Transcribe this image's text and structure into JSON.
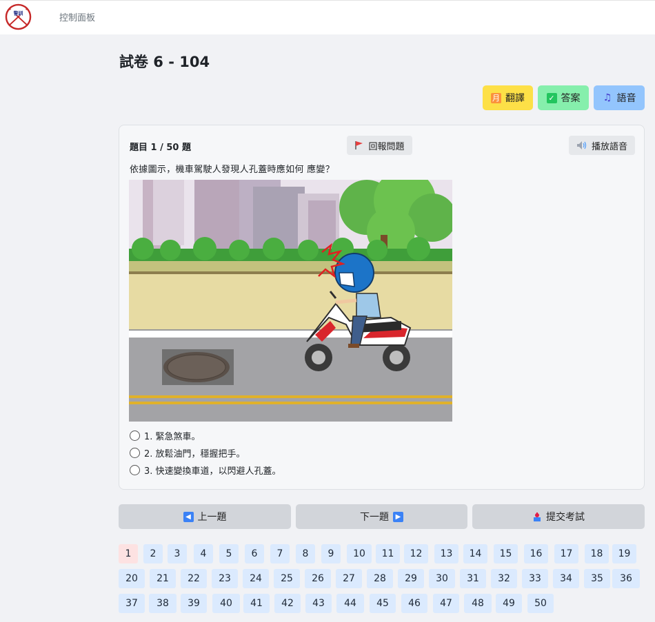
{
  "header": {
    "logo_label": "警訓",
    "nav_link": "控制面板"
  },
  "page": {
    "title": "試卷 6 - 104"
  },
  "toolbar": {
    "translate_label": "翻譯",
    "answer_label": "答案",
    "voice_label": "語音"
  },
  "question": {
    "counter": "題目 1 / 50 題",
    "report_label": "回報問題",
    "play_label": "播放語音",
    "text": "依據圖示，機車駕駛人發現人孔蓋時應如何 應變？",
    "image_icon": "scooter-manhole-illustration",
    "options": [
      "1. 緊急煞車。",
      "2. 放鬆油門，穩握把手。",
      "3. 快速變換車道，以閃避人孔蓋。"
    ]
  },
  "navigation": {
    "prev_label": "上一題",
    "next_label": "下一題",
    "submit_label": "提交考試"
  },
  "question_grid": {
    "current": 1,
    "numbers": [
      "1",
      "2",
      "3",
      "4",
      "5",
      "6",
      "7",
      "8",
      "9",
      "10",
      "11",
      "12",
      "13",
      "14",
      "15",
      "16",
      "17",
      "18",
      "19",
      "20",
      "21",
      "22",
      "23",
      "24",
      "25",
      "26",
      "27",
      "28",
      "29",
      "30",
      "31",
      "32",
      "33",
      "34",
      "35",
      "36",
      "37",
      "38",
      "39",
      "40",
      "41",
      "42",
      "43",
      "44",
      "45",
      "46",
      "47",
      "48",
      "49",
      "50"
    ]
  },
  "colors": {
    "translate_bg": "#fde047",
    "answer_bg": "#86efac",
    "voice_bg": "#93c5fd",
    "qnum_bg": "#dbeafe",
    "qnum_current_bg": "#fde2e2"
  }
}
